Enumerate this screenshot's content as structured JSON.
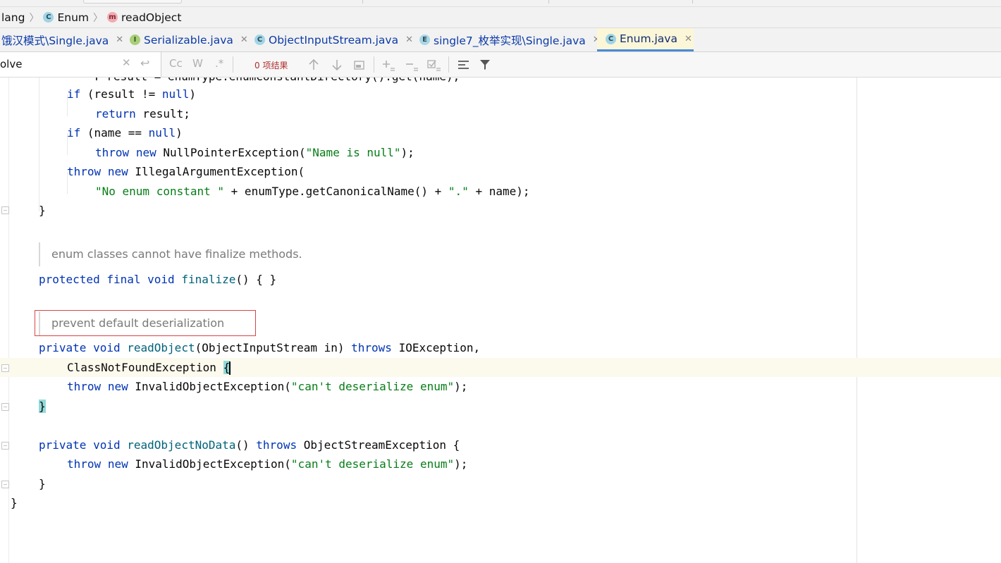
{
  "breadcrumb": {
    "items": [
      {
        "label": "lang",
        "icon": ""
      },
      {
        "label": "Enum",
        "icon": "class-icon"
      },
      {
        "label": "readObject",
        "icon": "method-icon"
      }
    ]
  },
  "tabs": [
    {
      "label": "饿汉模式\\Single.java",
      "icon": "",
      "active": false
    },
    {
      "label": "Serializable.java",
      "icon": "interface-icon",
      "active": false
    },
    {
      "label": "ObjectInputStream.java",
      "icon": "class-icon",
      "active": false
    },
    {
      "label": "single7_枚举实现\\Single.java",
      "icon": "enum-icon",
      "active": false
    },
    {
      "label": "Enum.java",
      "icon": "class-icon",
      "active": true
    }
  ],
  "search": {
    "value": "olve",
    "result_count": "0 项结果",
    "case_option": "Cc",
    "words_option": "W",
    "regex_option": ".*"
  },
  "docs": {
    "finalize": "enum classes cannot have finalize methods.",
    "readObject": "prevent default deserialization"
  },
  "code": {
    "top_partial": "        T result = enumType.enumConstantDirectory().get(name);",
    "if_result": "(result != ",
    "if_result_end": ")",
    "return_result": " result;",
    "if_name": "(name == ",
    "npe_ctor": "NullPointerException(",
    "npe_msg": "\"Name is null\"",
    "iae_ctor": "IllegalArgumentException(",
    "no_enum_str": "\"No enum constant \"",
    "no_enum_mid": " + enumType.getCanonicalName() + ",
    "dot_str": "\".\"",
    "no_enum_end": " + name);",
    "close_brace": "}",
    "finalize_name": "finalize",
    "finalize_tail": "() { }",
    "readObject_name": "readObject",
    "readObject_params": "(ObjectInputStream in) ",
    "ioexception": " IOException,",
    "cnfe": "ClassNotFoundException ",
    "open_brace": "{",
    "ioe_ctor": "InvalidObjectException(",
    "ioe_msg": "\"can't deserialize enum\"",
    "stmt_end": ");",
    "readObjectNoData_name": "readObjectNoData",
    "readObjectNoData_params": "() ",
    "ose": " ObjectStreamException {",
    "kw_if": "if",
    "kw_null": "null",
    "kw_return": "return",
    "kw_throw": "throw",
    "kw_new": "new",
    "kw_protected": "protected",
    "kw_final": "final",
    "kw_void": "void",
    "kw_private": "private",
    "kw_throws": "throws"
  }
}
